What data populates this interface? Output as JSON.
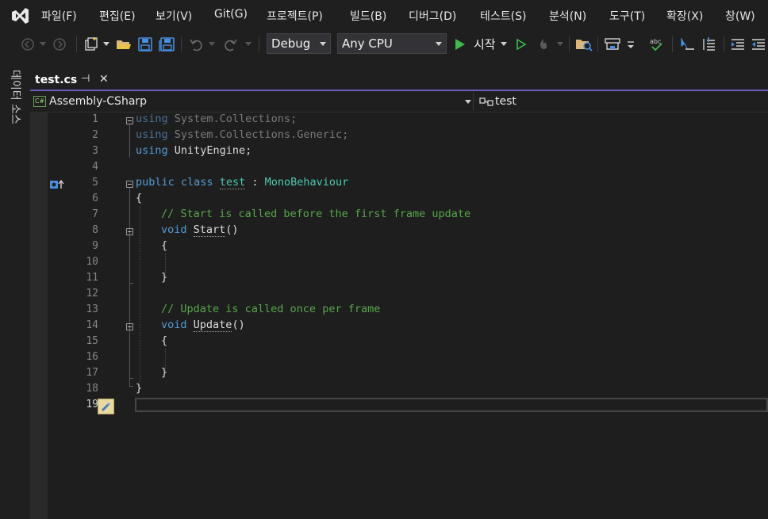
{
  "menu": {
    "items": [
      "파일(F)",
      "편집(E)",
      "보기(V)",
      "Git(G)",
      "프로젝트(P)",
      "빌드(B)",
      "디버그(D)",
      "테스트(S)",
      "분석(N)",
      "도구(T)",
      "확장(X)",
      "창(W)"
    ]
  },
  "toolbar": {
    "config": "Debug",
    "platform": "Any CPU",
    "start_label": "시작"
  },
  "side_panel": {
    "label": "데이터 소스"
  },
  "tab": {
    "filename": "test.cs",
    "pin_icon": "⊣",
    "close_icon": "✕"
  },
  "navbar": {
    "project": "Assembly-CSharp",
    "project_badge": "C#",
    "member": "test"
  },
  "editor": {
    "line_numbers": [
      "1",
      "2",
      "3",
      "4",
      "5",
      "6",
      "7",
      "8",
      "9",
      "10",
      "11",
      "12",
      "13",
      "14",
      "15",
      "16",
      "17",
      "18",
      "19"
    ],
    "code": {
      "l1_kw": "using",
      "l1_rest": " System.Collections;",
      "l2_kw": "using",
      "l2_rest": " System.Collections.Generic;",
      "l3_kw": "using",
      "l3_rest": " UnityEngine;",
      "l5_public": "public",
      "l5_class": " class ",
      "l5_name": "test",
      "l5_colon": " : ",
      "l5_base": "MonoBehaviour",
      "l6": "{",
      "l7": "// Start is called before the first frame update",
      "l8_void": "void",
      "l8_name": "Start",
      "l8_parens": "()",
      "l9": "{",
      "l11": "}",
      "l13": "// Update is called once per frame",
      "l14_void": "void",
      "l14_name": "Update",
      "l14_parens": "()",
      "l15": "{",
      "l17": "}",
      "l18": "}"
    }
  },
  "colors": {
    "accent": "#6d5bbf",
    "keyword": "#569cd6",
    "type": "#4ec9b0",
    "comment": "#57a64a",
    "play": "#3fb950"
  }
}
